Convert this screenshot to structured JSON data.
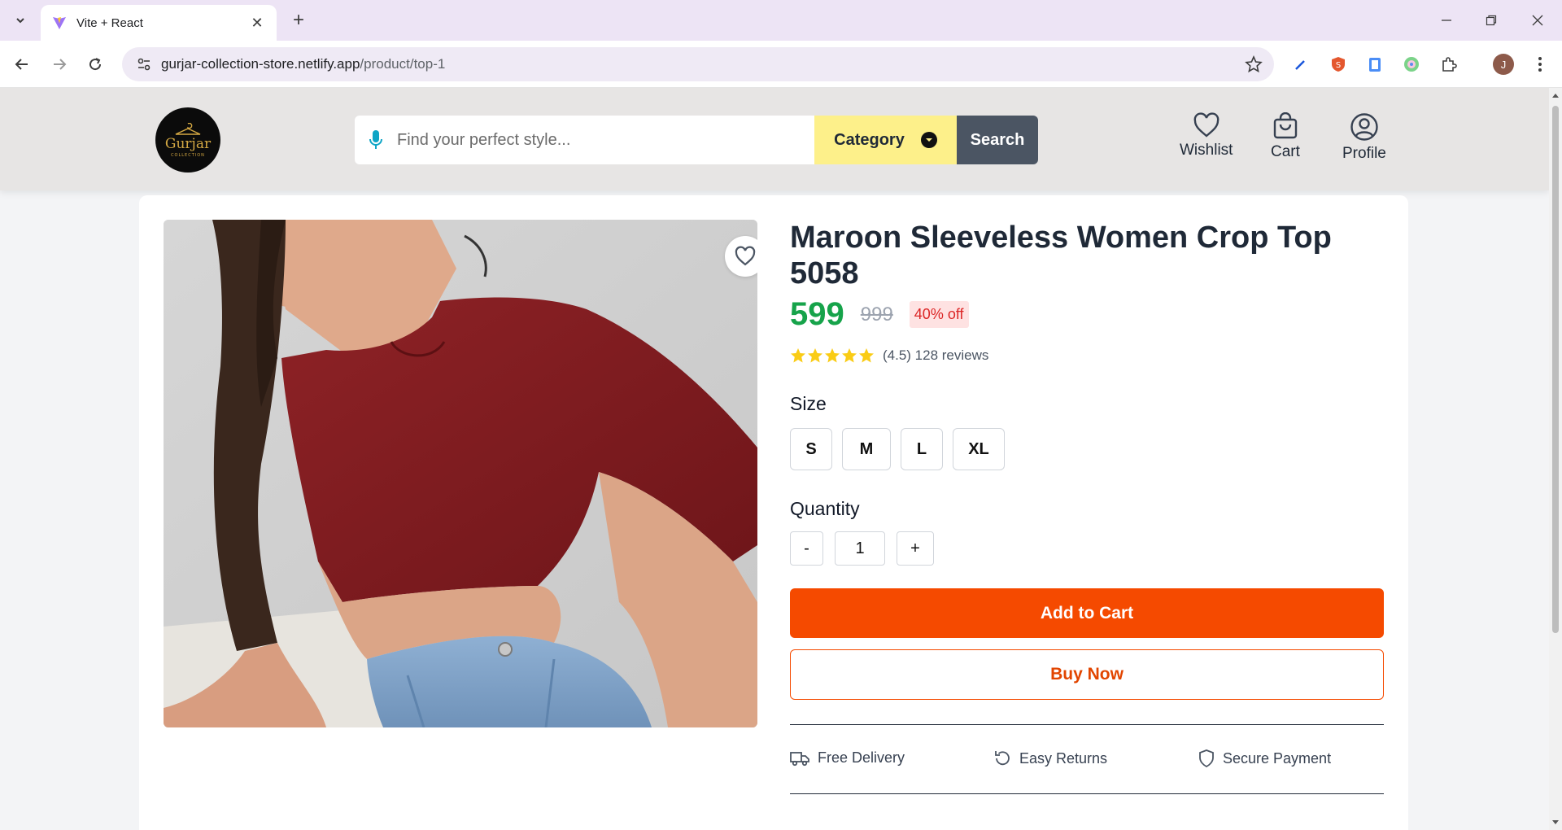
{
  "browser": {
    "tab_title": "Vite + React",
    "url_host": "gurjar-collection-store.netlify.app",
    "url_path": "/product/top-1",
    "profile_initial": "J"
  },
  "header": {
    "logo_text": "Gurjar",
    "logo_sub": "COLLECTION",
    "search_placeholder": "Find your perfect style...",
    "category_label": "Category",
    "search_label": "Search",
    "wishlist_label": "Wishlist",
    "cart_label": "Cart",
    "profile_label": "Profile"
  },
  "product": {
    "title": "Maroon Sleeveless Women Crop Top 5058",
    "price": "599",
    "mrp": "999",
    "discount": "40% off",
    "rating_text": "(4.5) 128 reviews",
    "rating_value": 4.5,
    "size_label": "Size",
    "sizes": [
      "S",
      "M",
      "L",
      "XL"
    ],
    "quantity_label": "Quantity",
    "qty_minus": "-",
    "qty_value": "1",
    "qty_plus": "+",
    "add_to_cart": "Add to Cart",
    "buy_now": "Buy Now",
    "features": {
      "delivery": "Free Delivery",
      "returns": "Easy Returns",
      "payment": "Secure Payment"
    }
  },
  "colors": {
    "accent": "#f54a00",
    "price_green": "#16a34a",
    "category_yellow": "#fdf08a",
    "search_gray": "#4b5563"
  }
}
